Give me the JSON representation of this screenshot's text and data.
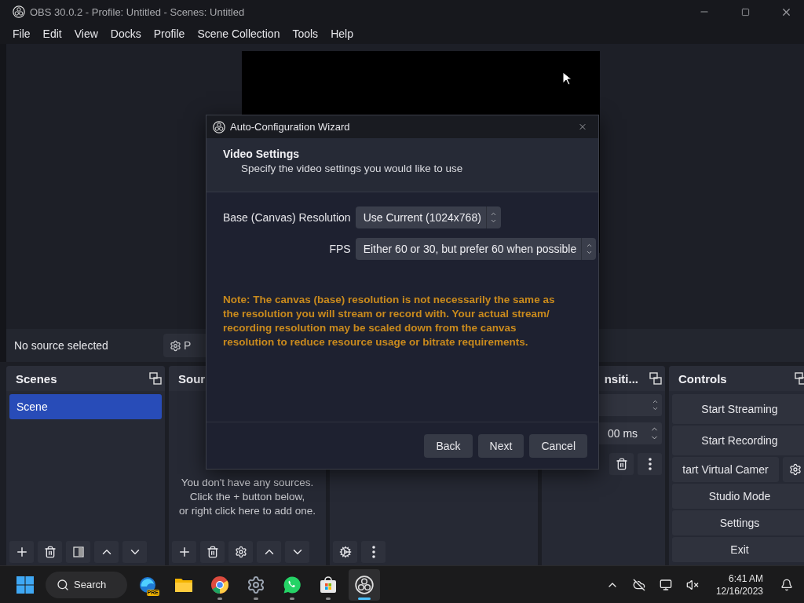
{
  "window": {
    "title": "OBS 30.0.2 - Profile: Untitled - Scenes: Untitled"
  },
  "menu": [
    "File",
    "Edit",
    "View",
    "Docks",
    "Profile",
    "Scene Collection",
    "Tools",
    "Help"
  ],
  "source_toolbar": {
    "status": "No source selected",
    "properties_button": "P"
  },
  "scenes": {
    "title": "Scenes",
    "items": [
      {
        "label": "Scene",
        "selected": true
      }
    ]
  },
  "sources": {
    "title": "Sour",
    "empty_message": "You don't have any sources.\nClick the + button below,\nor right click here to add one."
  },
  "transitions": {
    "title": "nsiti...",
    "duration": "00 ms"
  },
  "controls": {
    "title": "Controls",
    "buttons": [
      {
        "kind": "plain",
        "label": "Start Streaming"
      },
      {
        "kind": "plain",
        "label": "Start Recording"
      },
      {
        "kind": "split",
        "label": "tart Virtual Camer"
      },
      {
        "kind": "plain",
        "label": "Studio Mode"
      },
      {
        "kind": "plain",
        "label": "Settings"
      },
      {
        "kind": "plain",
        "label": "Exit"
      }
    ]
  },
  "dialog": {
    "title": "Auto-Configuration Wizard",
    "heading": "Video Settings",
    "subtitle": "Specify the video settings you would like to use",
    "fields": [
      {
        "label": "Base (Canvas) Resolution",
        "value": "Use Current (1024x768)"
      },
      {
        "label": "FPS",
        "value": "Either 60 or 30, but prefer 60 when possible"
      }
    ],
    "note": "Note: The canvas (base) resolution is not necessarily the same as the resolution you will stream or record with. Your actual stream/ recording resolution may be scaled down from the canvas resolution to reduce resource usage or bitrate requirements.",
    "buttons": [
      "Back",
      "Next",
      "Cancel"
    ]
  },
  "taskbar": {
    "search": "Search",
    "time": "6:41 AM",
    "date": "12/16/2023",
    "apps": [
      {
        "kind": "edge",
        "badge": "PRE",
        "running": false,
        "active": false
      },
      {
        "kind": "folder",
        "running": false,
        "active": false
      },
      {
        "kind": "chrome",
        "running": true,
        "active": false
      },
      {
        "kind": "gear",
        "running": true,
        "active": false
      },
      {
        "kind": "chat",
        "running": true,
        "active": false
      },
      {
        "kind": "store",
        "running": true,
        "active": false
      },
      {
        "kind": "obs",
        "running": true,
        "active": true
      }
    ]
  }
}
